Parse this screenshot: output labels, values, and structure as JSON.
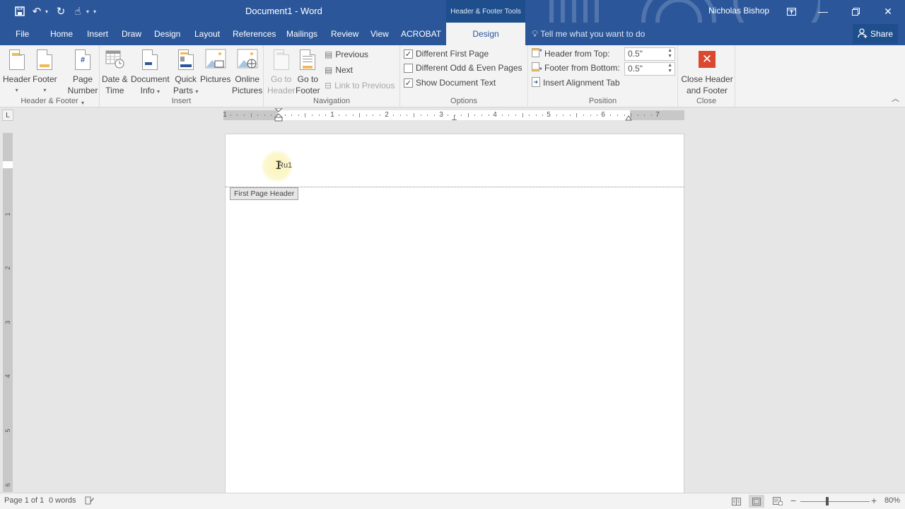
{
  "window": {
    "doc_title": "Document1 - Word",
    "context_tools_title": "Header & Footer Tools",
    "user_name": "Nicholas Bishop",
    "controls": [
      "ribbon-display-options",
      "minimize",
      "restore",
      "close"
    ]
  },
  "quick_access": {
    "icons": [
      "save-icon",
      "undo-icon",
      "redo-icon",
      "touch-mode-icon",
      "customize-icon"
    ]
  },
  "tabs": [
    {
      "label": "File"
    },
    {
      "label": "Home"
    },
    {
      "label": "Insert"
    },
    {
      "label": "Draw"
    },
    {
      "label": "Design"
    },
    {
      "label": "Layout"
    },
    {
      "label": "References"
    },
    {
      "label": "Mailings"
    },
    {
      "label": "Review"
    },
    {
      "label": "View"
    },
    {
      "label": "ACROBAT"
    },
    {
      "label": "Design",
      "active": true
    }
  ],
  "tell_me": {
    "placeholder": "Tell me what you want to do"
  },
  "share": {
    "label": "Share"
  },
  "ribbon": {
    "groups": {
      "header_footer": {
        "label": "Header & Footer",
        "header": "Header",
        "footer": "Footer",
        "page_number_1": "Page",
        "page_number_2": "Number"
      },
      "insert": {
        "label": "Insert",
        "date_time_1": "Date &",
        "date_time_2": "Time",
        "doc_info_1": "Document",
        "doc_info_2": "Info",
        "quick_parts_1": "Quick",
        "quick_parts_2": "Parts",
        "pictures": "Pictures",
        "online_pictures_1": "Online",
        "online_pictures_2": "Pictures"
      },
      "navigation": {
        "label": "Navigation",
        "go_to_header_1": "Go to",
        "go_to_header_2": "Header",
        "go_to_footer_1": "Go to",
        "go_to_footer_2": "Footer",
        "previous": "Previous",
        "next": "Next",
        "link_to_previous": "Link to Previous"
      },
      "options": {
        "label": "Options",
        "different_first_page": {
          "label": "Different First Page",
          "checked": true
        },
        "different_odd_even": {
          "label": "Different Odd & Even Pages",
          "checked": false
        },
        "show_document_text": {
          "label": "Show Document Text",
          "checked": true
        }
      },
      "position": {
        "label": "Position",
        "header_from_top": {
          "label": "Header from Top:",
          "value": "0.5\""
        },
        "footer_from_bottom": {
          "label": "Footer from Bottom:",
          "value": "0.5\""
        },
        "insert_alignment_tab": "Insert Alignment Tab"
      },
      "close": {
        "label": "Close",
        "close_1": "Close Header",
        "close_2": "and Footer"
      }
    }
  },
  "ruler": {
    "horizontal_numbers": [
      "1",
      "1",
      "2",
      "3",
      "4",
      "5",
      "6",
      "7"
    ],
    "vertical_numbers": [
      "1",
      "2",
      "3",
      "4",
      "5",
      "6"
    ]
  },
  "document": {
    "header_text": "Ru1",
    "header_tag": "First Page Header"
  },
  "status": {
    "page": "Page 1 of 1",
    "words": "0 words",
    "zoom": "80%",
    "zoom_percent": 80,
    "views": [
      "read-mode",
      "print-layout",
      "web-layout"
    ],
    "active_view": "print-layout"
  }
}
